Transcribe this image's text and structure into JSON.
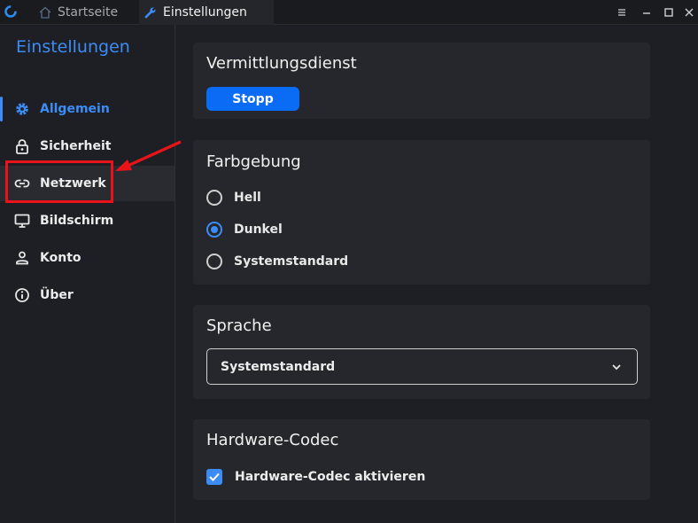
{
  "tabs": [
    {
      "label": "Startseite",
      "icon": "home-icon"
    },
    {
      "label": "Einstellungen",
      "icon": "wrench-icon"
    }
  ],
  "sidebar": {
    "title": "Einstellungen",
    "items": [
      {
        "label": "Allgemein",
        "icon": "gear-icon",
        "active": true
      },
      {
        "label": "Sicherheit",
        "icon": "lock-icon"
      },
      {
        "label": "Netzwerk",
        "icon": "link-icon"
      },
      {
        "label": "Bildschirm",
        "icon": "monitor-icon"
      },
      {
        "label": "Konto",
        "icon": "person-icon"
      },
      {
        "label": "Über",
        "icon": "info-icon"
      }
    ]
  },
  "sections": {
    "service": {
      "title": "Vermittlungsdienst",
      "button_label": "Stopp"
    },
    "theme": {
      "title": "Farbgebung",
      "options": [
        "Hell",
        "Dunkel",
        "Systemstandard"
      ],
      "selected": "Dunkel"
    },
    "language": {
      "title": "Sprache",
      "selected": "Systemstandard"
    },
    "codec": {
      "title": "Hardware-Codec",
      "checkbox_label": "Hardware-Codec aktivieren",
      "checked": true
    }
  },
  "colors": {
    "accent": "#3c8cf5",
    "button": "#0a6cf5",
    "annotation": "#e8141a",
    "background": "#1e1f24",
    "card": "#26272c"
  }
}
